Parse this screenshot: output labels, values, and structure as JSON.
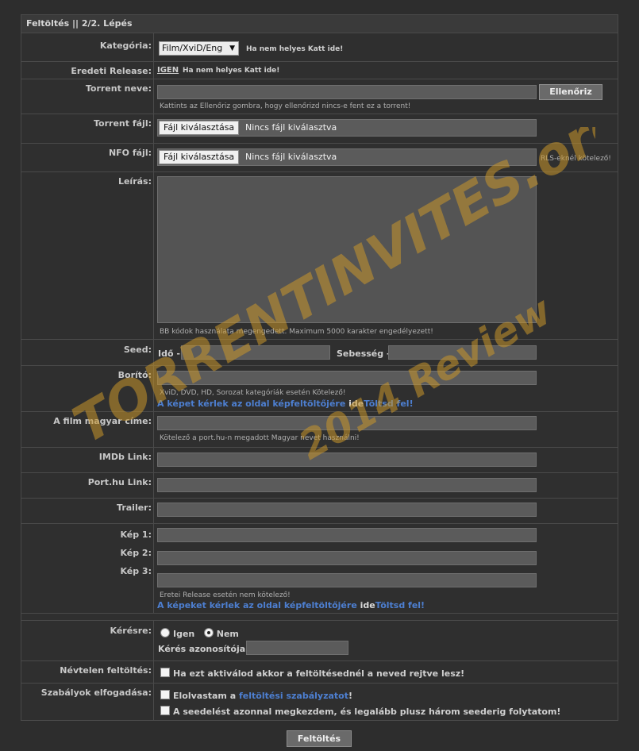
{
  "form": {
    "title": "Feltöltés || 2/2. Lépés",
    "category": {
      "label": "Kategória:",
      "selected": "Film/XviD/Eng",
      "hint": "Ha nem helyes Katt ide!"
    },
    "original_release": {
      "label": "Eredeti Release:",
      "value": "IGEN",
      "hint": "Ha nem helyes Katt ide!"
    },
    "torrent_name": {
      "label": "Torrent neve:",
      "button": "Ellenőriz",
      "hint": "Kattints az Ellenőriz gombra, hogy ellenőrizd nincs-e fent ez a torrent!"
    },
    "torrent_file": {
      "label": "Torrent fájl:",
      "button": "Fájl kiválasztása",
      "status": "Nincs fájl kiválasztva"
    },
    "nfo_file": {
      "label": "NFO fájl:",
      "button": "Fájl kiválasztása",
      "status": "Nincs fájl kiválasztva",
      "hint": "RLS-eknél kötelező!"
    },
    "description": {
      "label": "Leírás:",
      "hint": "BB kódok használata megengedett.  Maximum 5000 karakter engedélyezett!"
    },
    "seed": {
      "label": "Seed:",
      "time_label": "Idő -",
      "speed_label": "Sebesség -"
    },
    "cover": {
      "label": "Borító:",
      "hint": "XviD, DVD, HD, Sorozat kategóriák esetén Kötelező!",
      "link_pre": "A képet kérlek az oldal képfeltöltőjére",
      "link_mid": "ide",
      "link_post": "Töltsd fel!"
    },
    "hu_title": {
      "label": "A film magyar címe:",
      "hint": "Kötelező a port.hu-n megadott Magyar nevet használni!"
    },
    "imdb": {
      "label": "IMDb Link:"
    },
    "porthu": {
      "label": "Port.hu Link:"
    },
    "trailer": {
      "label": "Trailer:"
    },
    "images": {
      "label1": "Kép 1:",
      "label2": "Kép 2:",
      "label3": "Kép 3:",
      "hint": "Eretei Release esetén nem kötelező!",
      "link_pre": "A képeket kérlek az oldal képfeltöltőjére",
      "link_mid": "ide",
      "link_post": "Töltsd fel!"
    },
    "request": {
      "label": "Kérésre:",
      "yes": "Igen",
      "no": "Nem",
      "id_label": "Kérés azonosítója:",
      "selected": "Nem"
    },
    "anonymous": {
      "label": "Névtelen feltöltés:",
      "text": "Ha ezt aktiválod akkor a feltöltésednél a neved rejtve lesz!"
    },
    "rules": {
      "label": "Szabályok elfogadása:",
      "text1_pre": "Elolvastam a",
      "text1_link": "feltöltési szabályzatot",
      "text1_post": "!",
      "text2": "A seedelést azonnal megkezdem, és legalább plusz három seederig folytatom!"
    },
    "submit": "Feltöltés"
  },
  "watermark": {
    "line1": "TORRENTINVITES.org",
    "line2": "2014 Review",
    "color": "#c8962a"
  }
}
